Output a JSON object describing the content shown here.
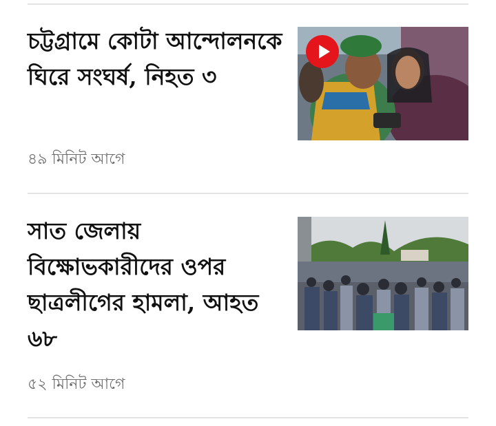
{
  "articles": [
    {
      "headline": "চট্টগ্রামে কোটা আন্দোলনকে ঘিরে সংঘর্ষ, নিহত ৩",
      "time": "৪৯ মিনিট আগে",
      "has_video": true,
      "play_icon": "play-icon"
    },
    {
      "headline": "সাত জেলায় বিক্ষোভকারীদের ওপর ছাত্রলীগের হামলা, আহত ৬৮",
      "time": "৫২ মিনিট আগে",
      "has_video": false
    }
  ],
  "colors": {
    "divider": "#e3e3e3",
    "time": "#6b6b6b",
    "play_button": "#e4161b"
  }
}
